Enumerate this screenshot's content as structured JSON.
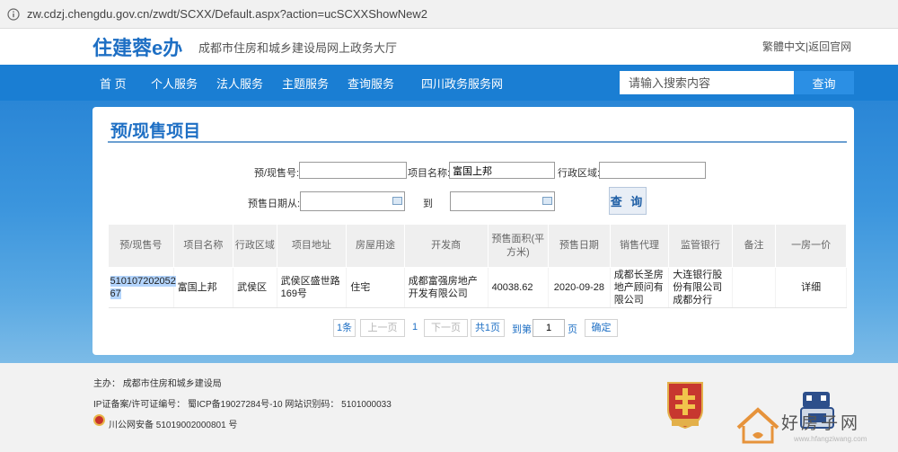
{
  "browser": {
    "url": "zw.cdzj.chengdu.gov.cn/zwdt/SCXX/Default.aspx?action=ucSCXXShowNew2"
  },
  "header": {
    "logo": "住建蓉e办",
    "subtitle": "成都市住房和城乡建设局网上政务大厅",
    "links": "繁體中文|返回官网"
  },
  "nav": {
    "items": [
      "首 页",
      "个人服务",
      "法人服务",
      "主题服务",
      "查询服务",
      "四川政务服务网"
    ],
    "search_placeholder": "请输入搜索内容",
    "search_button": "查询"
  },
  "panel": {
    "title": "预/现售项目",
    "form": {
      "presale_no_label": "预/现售号:",
      "presale_no_value": "",
      "project_name_label": "项目名称:",
      "project_name_value": "富国上邦",
      "district_label": "行政区域:",
      "district_value": "",
      "date_from_label": "预售日期从:",
      "date_to_label": "到",
      "query_button": "查 询"
    },
    "table": {
      "headers": [
        "预/现售号",
        "项目名称",
        "行政区域",
        "项目地址",
        "房屋用途",
        "开发商",
        "预售面积(平方米)",
        "预售日期",
        "销售代理",
        "监管银行",
        "备注",
        "一房一价"
      ],
      "rows": [
        {
          "presale_no": "510107202052 67",
          "project_name": "富国上邦",
          "district": "武侯区",
          "address": "武侯区盛世路169号",
          "usage": "住宅",
          "developer": "成都富强房地产开发有限公司",
          "area": "40038.62",
          "date": "2020-09-28",
          "agent": "成都长圣房地产顾问有限公司",
          "bank": "大连银行股份有限公司成都分行",
          "note": "",
          "detail": "详细"
        }
      ]
    },
    "pager": {
      "count": "1条",
      "prev": "上一页",
      "current": "1",
      "next": "下一页",
      "total_pages": "共1页",
      "goto_prefix": "到第",
      "goto_value": "1",
      "goto_suffix": "页",
      "confirm": "确定"
    }
  },
  "footer": {
    "sponsor": "主办：  成都市住房和城乡建设局",
    "icp": "IP证备案/许可证编号： 蜀ICP备19027284号-10   网站识别码： 5101000033",
    "police": "川公网安备 51019002000801 号"
  },
  "watermark": {
    "text": "好房子网",
    "url": "www.hfangziwang.com"
  },
  "colors": {
    "brand": "#1e6fc4",
    "nav_bg": "#1a7ed3",
    "search_btn": "#2b8fe4"
  }
}
